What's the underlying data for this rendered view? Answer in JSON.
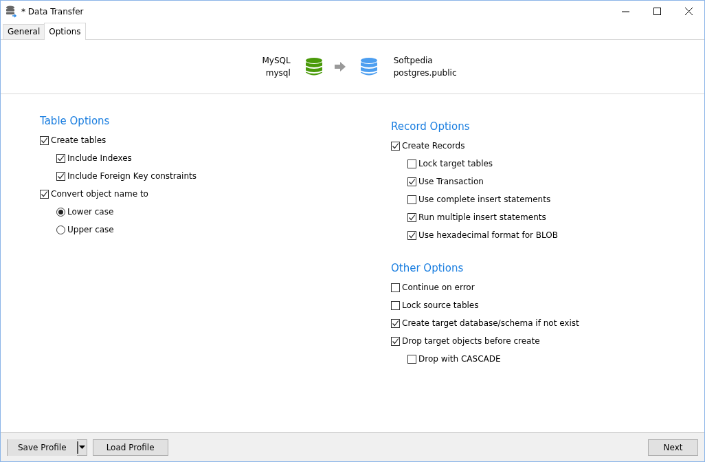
{
  "window": {
    "title": "* Data Transfer"
  },
  "tabs": [
    {
      "label": "General",
      "selected": false
    },
    {
      "label": "Options",
      "selected": true
    }
  ],
  "transfer": {
    "source": {
      "server": "MySQL",
      "database": "mysql"
    },
    "target": {
      "server": "Softpedia",
      "database": "postgres.public"
    }
  },
  "left_column": [
    {
      "title": "Table Options",
      "options": [
        {
          "kind": "checkbox",
          "label": "Create tables",
          "checked": true,
          "children": [
            {
              "kind": "checkbox",
              "label": "Include Indexes",
              "checked": true
            },
            {
              "kind": "checkbox",
              "label": "Include Foreign Key constraints",
              "checked": true
            }
          ]
        },
        {
          "kind": "checkbox",
          "label": "Convert object name to",
          "checked": true,
          "children": [
            {
              "kind": "radio",
              "label": "Lower case",
              "selected": true
            },
            {
              "kind": "radio",
              "label": "Upper case",
              "selected": false
            }
          ]
        }
      ]
    }
  ],
  "right_column": [
    {
      "title": "Record Options",
      "options": [
        {
          "kind": "checkbox",
          "label": "Create Records",
          "checked": true,
          "children": [
            {
              "kind": "checkbox",
              "label": "Lock target tables",
              "checked": false
            },
            {
              "kind": "checkbox",
              "label": "Use Transaction",
              "checked": true
            },
            {
              "kind": "checkbox",
              "label": "Use complete insert statements",
              "checked": false
            },
            {
              "kind": "checkbox",
              "label": "Run multiple insert statements",
              "checked": true
            },
            {
              "kind": "checkbox",
              "label": "Use hexadecimal format for BLOB",
              "checked": true
            }
          ]
        }
      ]
    },
    {
      "title": "Other Options",
      "options": [
        {
          "kind": "checkbox",
          "label": "Continue on error",
          "checked": false
        },
        {
          "kind": "checkbox",
          "label": "Lock source tables",
          "checked": false
        },
        {
          "kind": "checkbox",
          "label": "Create target database/schema if not exist",
          "checked": true
        },
        {
          "kind": "checkbox",
          "label": "Drop target objects before create",
          "checked": true,
          "children": [
            {
              "kind": "checkbox",
              "label": "Drop with CASCADE",
              "checked": false
            }
          ]
        }
      ]
    }
  ],
  "footer": {
    "left_buttons": [
      "Save Profile",
      "Load Profile"
    ],
    "right_buttons": [
      "Next"
    ]
  }
}
